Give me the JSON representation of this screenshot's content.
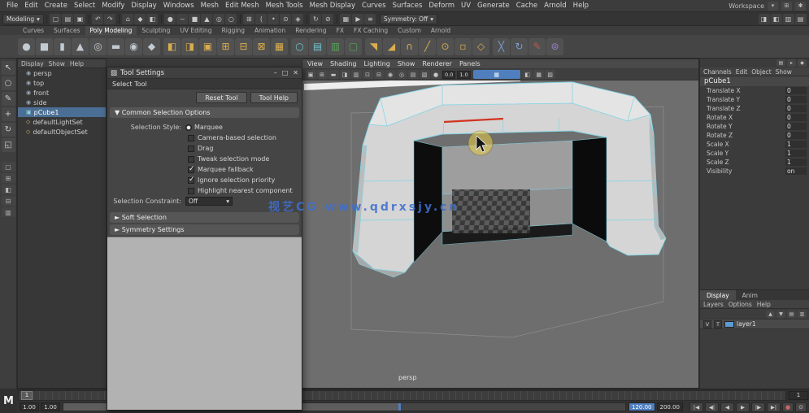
{
  "watermark": {
    "text": "视艺CG www.qdrxsjy.cn",
    "color": "#3f6fd0"
  },
  "logo": "M",
  "menubar": {
    "items": [
      "File",
      "Edit",
      "Create",
      "Select",
      "Modify",
      "Display",
      "Windows",
      "Mesh",
      "Edit Mesh",
      "Mesh Tools",
      "Mesh Display",
      "Curves",
      "Surfaces",
      "Deform",
      "UV",
      "Generate",
      "Cache",
      "Arnold",
      "Help"
    ],
    "workspace_label": "Workspace"
  },
  "statusline": {
    "menuset": "Modeling",
    "arrow": "▾",
    "symmetry": "Symmetry: Off",
    "icons": [
      {
        "kind": "sep"
      },
      {
        "kind": "icon",
        "name": "new-scene-icon",
        "glyph": "▢"
      },
      {
        "kind": "icon",
        "name": "open-scene-icon",
        "glyph": "▤"
      },
      {
        "kind": "icon",
        "name": "save-scene-icon",
        "glyph": "▣"
      },
      {
        "kind": "sep"
      },
      {
        "kind": "icon",
        "name": "undo-icon",
        "glyph": "↶"
      },
      {
        "kind": "icon",
        "name": "redo-icon",
        "glyph": "↷"
      },
      {
        "kind": "sep"
      },
      {
        "kind": "icon",
        "name": "select-hierarchy-icon",
        "glyph": "⌂"
      },
      {
        "kind": "icon",
        "name": "select-object-icon",
        "glyph": "◆"
      },
      {
        "kind": "icon",
        "name": "select-component-icon",
        "glyph": "◧"
      },
      {
        "kind": "sep"
      },
      {
        "kind": "icon",
        "name": "mask-points-icon",
        "glyph": "●"
      },
      {
        "kind": "icon",
        "name": "mask-curves-icon",
        "glyph": "~"
      },
      {
        "kind": "icon",
        "name": "mask-surfaces-icon",
        "glyph": "■"
      },
      {
        "kind": "icon",
        "name": "mask-deformations-icon",
        "glyph": "▲"
      },
      {
        "kind": "icon",
        "name": "mask-dynamics-icon",
        "glyph": "◎"
      },
      {
        "kind": "icon",
        "name": "mask-rendering-icon",
        "glyph": "○"
      },
      {
        "kind": "sep"
      },
      {
        "kind": "icon",
        "name": "snap-to-grid-icon",
        "glyph": "⊞"
      },
      {
        "kind": "icon",
        "name": "snap-to-curve-icon",
        "glyph": "("
      },
      {
        "kind": "icon",
        "name": "snap-to-point-icon",
        "glyph": "•"
      },
      {
        "kind": "icon",
        "name": "snap-to-projected-center-icon",
        "glyph": "⊙"
      },
      {
        "kind": "icon",
        "name": "make-live-icon",
        "glyph": "◈"
      },
      {
        "kind": "sep"
      },
      {
        "kind": "icon",
        "name": "construction-history-icon",
        "glyph": "↻"
      },
      {
        "kind": "icon",
        "name": "no-history-icon",
        "glyph": "⊘"
      },
      {
        "kind": "sep"
      },
      {
        "kind": "icon",
        "name": "render-current-frame-icon",
        "glyph": "▦"
      },
      {
        "kind": "icon",
        "name": "ipr-render-icon",
        "glyph": "▶"
      },
      {
        "kind": "icon",
        "name": "render-settings-icon",
        "glyph": "≡"
      }
    ],
    "right_icons": [
      {
        "name": "attribute-editor-toggle",
        "glyph": "◨"
      },
      {
        "name": "tool-settings-toggle",
        "glyph": "◧"
      },
      {
        "name": "channel-box-toggle",
        "glyph": "▥"
      },
      {
        "name": "modeling-toolkit-toggle",
        "glyph": "▤"
      }
    ]
  },
  "shelf": {
    "tabs": [
      {
        "label": "Curves",
        "state": ""
      },
      {
        "label": "Surfaces",
        "state": ""
      },
      {
        "label": "Poly Modeling",
        "state": "active"
      },
      {
        "label": "Sculpting",
        "state": ""
      },
      {
        "label": "UV Editing",
        "state": ""
      },
      {
        "label": "Rigging",
        "state": ""
      },
      {
        "label": "Animation",
        "state": ""
      },
      {
        "label": "Rendering",
        "state": ""
      },
      {
        "label": "FX",
        "state": ""
      },
      {
        "label": "FX Caching",
        "state": ""
      },
      {
        "label": "Custom",
        "state": ""
      },
      {
        "label": "Arnold",
        "state": ""
      }
    ],
    "items": [
      {
        "kind": "icon",
        "name": "poly-sphere-icon",
        "glyph": "●",
        "color": "#c2cad2"
      },
      {
        "kind": "icon",
        "name": "poly-cube-icon",
        "glyph": "■",
        "color": "#c2cad2"
      },
      {
        "kind": "icon",
        "name": "poly-cylinder-icon",
        "glyph": "▮",
        "color": "#c2cad2"
      },
      {
        "kind": "icon",
        "name": "poly-cone-icon",
        "glyph": "▲",
        "color": "#c2cad2"
      },
      {
        "kind": "icon",
        "name": "poly-torus-icon",
        "glyph": "◎",
        "color": "#c2cad2"
      },
      {
        "kind": "icon",
        "name": "poly-plane-icon",
        "glyph": "▬",
        "color": "#c2cad2"
      },
      {
        "kind": "icon",
        "name": "poly-disc-icon",
        "glyph": "◉",
        "color": "#c2cad2"
      },
      {
        "kind": "icon",
        "name": "poly-platonic-icon",
        "glyph": "◆",
        "color": "#c2cad2"
      },
      {
        "kind": "sep"
      },
      {
        "kind": "icon",
        "name": "boolean-union-icon",
        "glyph": "◧",
        "color": "#d9ad4f"
      },
      {
        "kind": "icon",
        "name": "boolean-difference-icon",
        "glyph": "◨",
        "color": "#d9ad4f"
      },
      {
        "kind": "icon",
        "name": "boolean-intersection-icon",
        "glyph": "▣",
        "color": "#d9ad4f"
      },
      {
        "kind": "icon",
        "name": "combine-icon",
        "glyph": "⊞",
        "color": "#d9ad4f"
      },
      {
        "kind": "icon",
        "name": "separate-icon",
        "glyph": "⊟",
        "color": "#d9ad4f"
      },
      {
        "kind": "icon",
        "name": "extract-icon",
        "glyph": "⊠",
        "color": "#d9ad4f"
      },
      {
        "kind": "icon",
        "name": "fill-hole-icon",
        "glyph": "▦",
        "color": "#d9ad4f"
      },
      {
        "kind": "sep"
      },
      {
        "kind": "icon",
        "name": "smooth-icon",
        "glyph": "○",
        "color": "#6fc3d0"
      },
      {
        "kind": "icon",
        "name": "subdivide-icon",
        "glyph": "▤",
        "color": "#6fc3d0"
      },
      {
        "kind": "icon",
        "name": "symmetry-toggle-icon",
        "glyph": "▥",
        "color": "#55a558"
      },
      {
        "kind": "icon",
        "name": "object-symmetry-icon",
        "glyph": "▢",
        "color": "#55a558"
      },
      {
        "kind": "sep"
      },
      {
        "kind": "icon",
        "name": "extrude-icon",
        "glyph": "◥",
        "color": "#d9ad4f"
      },
      {
        "kind": "icon",
        "name": "bevel-icon",
        "glyph": "◢",
        "color": "#d9ad4f"
      },
      {
        "kind": "icon",
        "name": "bridge-icon",
        "glyph": "∩",
        "color": "#d9ad4f"
      },
      {
        "kind": "icon",
        "name": "multi-cut-icon",
        "glyph": "╱",
        "color": "#d9ad4f"
      },
      {
        "kind": "icon",
        "name": "target-weld-icon",
        "glyph": "⊙",
        "color": "#d9ad4f"
      },
      {
        "kind": "icon",
        "name": "quad-draw-icon",
        "glyph": "▫",
        "color": "#d9ad4f"
      },
      {
        "kind": "icon",
        "name": "mirror-icon",
        "glyph": "◇",
        "color": "#d9ad4f"
      },
      {
        "kind": "sep"
      },
      {
        "kind": "icon",
        "name": "crease-icon",
        "glyph": "╳",
        "color": "#7d9fd4"
      },
      {
        "kind": "icon",
        "name": "spin-edge-icon",
        "glyph": "↻",
        "color": "#7d9fd4"
      },
      {
        "kind": "icon",
        "name": "sculpt-brush-icon",
        "glyph": "✎",
        "color": "#c05848"
      },
      {
        "kind": "icon",
        "name": "soft-select-icon",
        "glyph": "⊚",
        "color": "#9b7fc9"
      }
    ]
  },
  "toolbox": {
    "tools": [
      {
        "name": "select-tool-icon",
        "glyph": "↖"
      },
      {
        "name": "lasso-tool-icon",
        "glyph": "○"
      },
      {
        "name": "paint-select-tool-icon",
        "glyph": "✎"
      },
      {
        "name": "move-tool-icon",
        "glyph": "+"
      },
      {
        "name": "rotate-tool-icon",
        "glyph": "↻"
      },
      {
        "name": "scale-tool-icon",
        "glyph": "◱"
      }
    ],
    "layouts": [
      {
        "name": "layout-single-pane-icon",
        "glyph": "▢"
      },
      {
        "name": "layout-four-pane-icon",
        "glyph": "⊞"
      },
      {
        "name": "layout-two-pane-side-icon",
        "glyph": "◧"
      },
      {
        "name": "layout-two-pane-stacked-icon",
        "glyph": "⊟"
      },
      {
        "name": "layout-outliner-persp-icon",
        "glyph": "▥"
      }
    ]
  },
  "outliner": {
    "menu": [
      "Display",
      "Show",
      "Help"
    ],
    "items": [
      {
        "label": "persp",
        "glyph": "◉",
        "color": "#9aa7b4",
        "state": ""
      },
      {
        "label": "top",
        "glyph": "◉",
        "color": "#9aa7b4",
        "state": ""
      },
      {
        "label": "front",
        "glyph": "◉",
        "color": "#9aa7b4",
        "state": ""
      },
      {
        "label": "side",
        "glyph": "◉",
        "color": "#9aa7b4",
        "state": ""
      },
      {
        "label": "pCube1",
        "glyph": "▣",
        "color": "#8fd0e0",
        "state": "selected"
      },
      {
        "label": "defaultLightSet",
        "glyph": "◇",
        "color": "#d2c06a",
        "state": ""
      },
      {
        "label": "defaultObjectSet",
        "glyph": "◇",
        "color": "#d2c06a",
        "state": ""
      }
    ]
  },
  "tool_settings": {
    "title": "Tool Settings",
    "window_buttons": [
      {
        "name": "minimize-button",
        "glyph": "–"
      },
      {
        "name": "maximize-button",
        "glyph": "□"
      },
      {
        "name": "close-button",
        "glyph": "✕"
      }
    ],
    "tool_name": "Select Tool",
    "reset_label": "Reset Tool",
    "help_label": "Tool Help",
    "common_section": "▼  Common Selection Options",
    "options": {
      "selection_style_label": "Selection Style:",
      "selection_style_value": "Marquee",
      "checkboxes": [
        {
          "label": "Camera-based selection",
          "state": "unchecked"
        },
        {
          "label": "Drag",
          "state": "unchecked"
        },
        {
          "label": "Tweak selection mode",
          "state": "unchecked"
        },
        {
          "label": "Marquee fallback",
          "state": "checked"
        },
        {
          "label": "Ignore selection priority",
          "state": "checked"
        },
        {
          "label": "Highlight nearest component",
          "state": "unchecked"
        }
      ],
      "constraint_label": "Selection Constraint:",
      "constraint_value": "Off"
    },
    "collapsed_sections": [
      "►  Soft Selection",
      "►  Symmetry Settings"
    ]
  },
  "viewport": {
    "menu": [
      "View",
      "Shading",
      "Lighting",
      "Show",
      "Renderer",
      "Panels"
    ],
    "toolbar_icons": [
      {
        "name": "camera-attributes-icon",
        "glyph": "▣"
      },
      {
        "name": "grid-toggle-icon",
        "glyph": "⊞"
      },
      {
        "name": "film-gate-icon",
        "glyph": "▬"
      },
      {
        "name": "resolution-gate-icon",
        "glyph": "◨"
      },
      {
        "name": "gate-mask-icon",
        "glyph": "▥"
      },
      {
        "name": "field-chart-icon",
        "glyph": "⊡"
      },
      {
        "name": "safe-action-icon",
        "glyph": "⊟"
      },
      {
        "name": "safe-title-icon",
        "glyph": "◉"
      },
      {
        "name": "lighting-toggle-icon",
        "glyph": "◎"
      },
      {
        "name": "shadows-toggle-icon",
        "glyph": "▤"
      },
      {
        "name": "ambient-occlusion-icon",
        "glyph": "▧"
      },
      {
        "name": "anti-aliasing-icon",
        "glyph": "●"
      }
    ],
    "exposure": "0.0",
    "gamma": "1.0",
    "right_icons": [
      {
        "name": "isolate-select-icon",
        "glyph": "◧"
      },
      {
        "name": "xray-toggle-icon",
        "glyph": "▦"
      },
      {
        "name": "wireframe-on-shaded-icon",
        "glyph": "▨"
      }
    ],
    "camera_label": "persp",
    "scene": {
      "object": "U-shaped polygon mesh with selected wireframe",
      "wireframe_color": "#7fd4e6",
      "selected_edge_color": "#d23420",
      "background_color": "#6e6e6e"
    }
  },
  "channel_box": {
    "top_icons": [
      {
        "name": "channel-display-icon",
        "glyph": "▤"
      },
      {
        "name": "channel-speed-icon",
        "glyph": "▸"
      },
      {
        "name": "channel-pin-icon",
        "glyph": "◆"
      }
    ],
    "menu": [
      "Channels",
      "Edit",
      "Object",
      "Show"
    ],
    "object_name": "pCube1",
    "channels": [
      {
        "name": "Translate X",
        "value": "0"
      },
      {
        "name": "Translate Y",
        "value": "0"
      },
      {
        "name": "Translate Z",
        "value": "0"
      },
      {
        "name": "Rotate X",
        "value": "0"
      },
      {
        "name": "Rotate Y",
        "value": "0"
      },
      {
        "name": "Rotate Z",
        "value": "0"
      },
      {
        "name": "Scale X",
        "value": "1"
      },
      {
        "name": "Scale Y",
        "value": "1"
      },
      {
        "name": "Scale Z",
        "value": "1"
      },
      {
        "name": "Visibility",
        "value": "on"
      }
    ]
  },
  "layer_editor": {
    "tabs": [
      {
        "label": "Display",
        "state": "active"
      },
      {
        "label": "Anim",
        "state": ""
      }
    ],
    "menu": [
      "Layers",
      "Options",
      "Help"
    ],
    "toolbar_icons": [
      {
        "name": "move-layer-up-icon",
        "glyph": "▲"
      },
      {
        "name": "move-layer-down-icon",
        "glyph": "▼"
      },
      {
        "name": "empty-layer-icon",
        "glyph": "▤"
      },
      {
        "name": "new-layer-icon",
        "glyph": "▥"
      }
    ],
    "layer": {
      "visibility": "V",
      "display_type": "T",
      "name": "layer1",
      "swatch_color": "#5b9bd5"
    }
  },
  "timeline": {
    "current_frame": "1",
    "range": {
      "animation_start": "1.00",
      "playback_start": "1.00",
      "playback_end": "120.00",
      "animation_end": "200.00"
    },
    "transport": [
      {
        "name": "go-to-start-button",
        "glyph": "|◀"
      },
      {
        "name": "step-back-key-button",
        "glyph": "◀|"
      },
      {
        "name": "play-backwards-button",
        "glyph": "◀"
      },
      {
        "name": "play-forwards-button",
        "glyph": "▶"
      },
      {
        "name": "step-forward-key-button",
        "glyph": "|▶"
      },
      {
        "name": "go-to-end-button",
        "glyph": "▶|"
      }
    ]
  }
}
